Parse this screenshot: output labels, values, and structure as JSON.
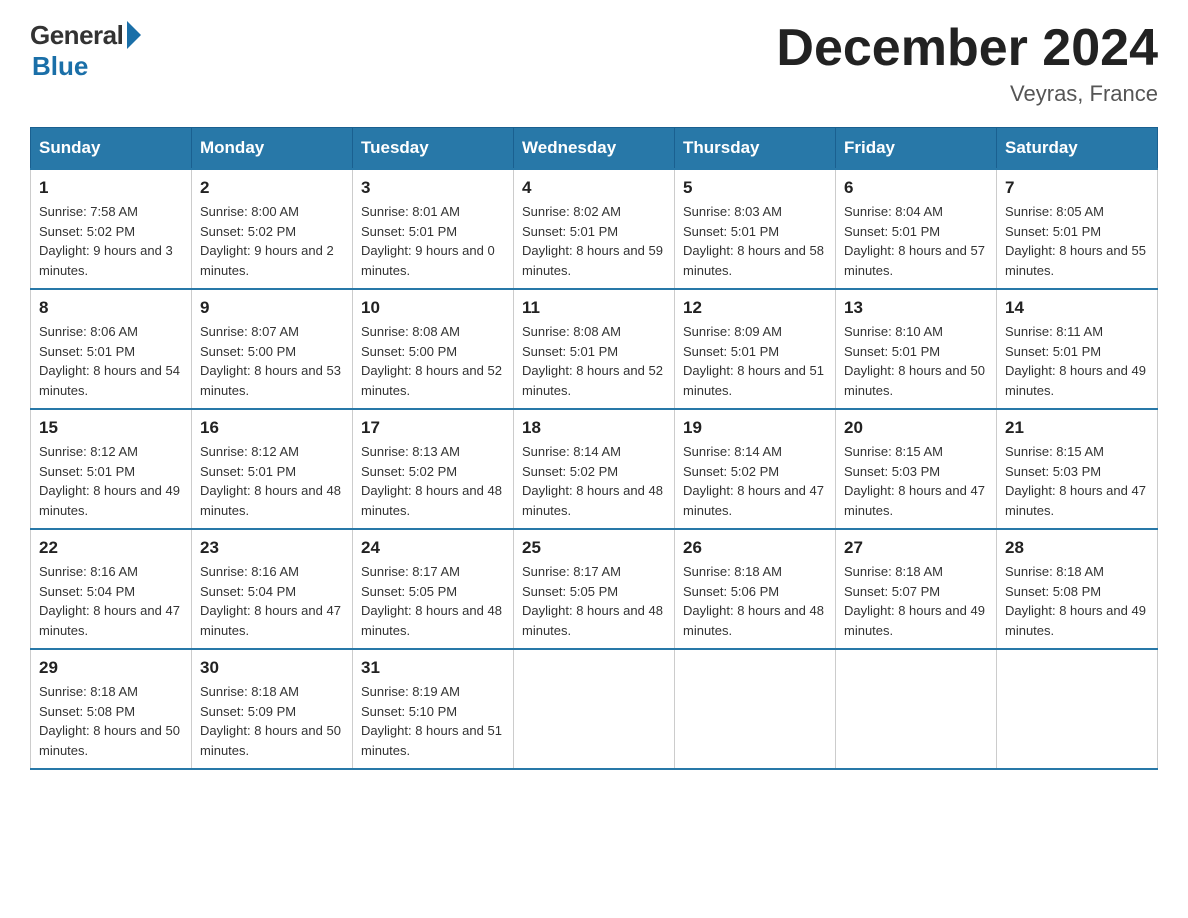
{
  "header": {
    "logo": {
      "general": "General",
      "blue": "Blue"
    },
    "title": "December 2024",
    "location": "Veyras, France"
  },
  "days_of_week": [
    "Sunday",
    "Monday",
    "Tuesday",
    "Wednesday",
    "Thursday",
    "Friday",
    "Saturday"
  ],
  "weeks": [
    [
      {
        "day": "1",
        "sunrise": "7:58 AM",
        "sunset": "5:02 PM",
        "daylight": "9 hours and 3 minutes."
      },
      {
        "day": "2",
        "sunrise": "8:00 AM",
        "sunset": "5:02 PM",
        "daylight": "9 hours and 2 minutes."
      },
      {
        "day": "3",
        "sunrise": "8:01 AM",
        "sunset": "5:01 PM",
        "daylight": "9 hours and 0 minutes."
      },
      {
        "day": "4",
        "sunrise": "8:02 AM",
        "sunset": "5:01 PM",
        "daylight": "8 hours and 59 minutes."
      },
      {
        "day": "5",
        "sunrise": "8:03 AM",
        "sunset": "5:01 PM",
        "daylight": "8 hours and 58 minutes."
      },
      {
        "day": "6",
        "sunrise": "8:04 AM",
        "sunset": "5:01 PM",
        "daylight": "8 hours and 57 minutes."
      },
      {
        "day": "7",
        "sunrise": "8:05 AM",
        "sunset": "5:01 PM",
        "daylight": "8 hours and 55 minutes."
      }
    ],
    [
      {
        "day": "8",
        "sunrise": "8:06 AM",
        "sunset": "5:01 PM",
        "daylight": "8 hours and 54 minutes."
      },
      {
        "day": "9",
        "sunrise": "8:07 AM",
        "sunset": "5:00 PM",
        "daylight": "8 hours and 53 minutes."
      },
      {
        "day": "10",
        "sunrise": "8:08 AM",
        "sunset": "5:00 PM",
        "daylight": "8 hours and 52 minutes."
      },
      {
        "day": "11",
        "sunrise": "8:08 AM",
        "sunset": "5:01 PM",
        "daylight": "8 hours and 52 minutes."
      },
      {
        "day": "12",
        "sunrise": "8:09 AM",
        "sunset": "5:01 PM",
        "daylight": "8 hours and 51 minutes."
      },
      {
        "day": "13",
        "sunrise": "8:10 AM",
        "sunset": "5:01 PM",
        "daylight": "8 hours and 50 minutes."
      },
      {
        "day": "14",
        "sunrise": "8:11 AM",
        "sunset": "5:01 PM",
        "daylight": "8 hours and 49 minutes."
      }
    ],
    [
      {
        "day": "15",
        "sunrise": "8:12 AM",
        "sunset": "5:01 PM",
        "daylight": "8 hours and 49 minutes."
      },
      {
        "day": "16",
        "sunrise": "8:12 AM",
        "sunset": "5:01 PM",
        "daylight": "8 hours and 48 minutes."
      },
      {
        "day": "17",
        "sunrise": "8:13 AM",
        "sunset": "5:02 PM",
        "daylight": "8 hours and 48 minutes."
      },
      {
        "day": "18",
        "sunrise": "8:14 AM",
        "sunset": "5:02 PM",
        "daylight": "8 hours and 48 minutes."
      },
      {
        "day": "19",
        "sunrise": "8:14 AM",
        "sunset": "5:02 PM",
        "daylight": "8 hours and 47 minutes."
      },
      {
        "day": "20",
        "sunrise": "8:15 AM",
        "sunset": "5:03 PM",
        "daylight": "8 hours and 47 minutes."
      },
      {
        "day": "21",
        "sunrise": "8:15 AM",
        "sunset": "5:03 PM",
        "daylight": "8 hours and 47 minutes."
      }
    ],
    [
      {
        "day": "22",
        "sunrise": "8:16 AM",
        "sunset": "5:04 PM",
        "daylight": "8 hours and 47 minutes."
      },
      {
        "day": "23",
        "sunrise": "8:16 AM",
        "sunset": "5:04 PM",
        "daylight": "8 hours and 47 minutes."
      },
      {
        "day": "24",
        "sunrise": "8:17 AM",
        "sunset": "5:05 PM",
        "daylight": "8 hours and 48 minutes."
      },
      {
        "day": "25",
        "sunrise": "8:17 AM",
        "sunset": "5:05 PM",
        "daylight": "8 hours and 48 minutes."
      },
      {
        "day": "26",
        "sunrise": "8:18 AM",
        "sunset": "5:06 PM",
        "daylight": "8 hours and 48 minutes."
      },
      {
        "day": "27",
        "sunrise": "8:18 AM",
        "sunset": "5:07 PM",
        "daylight": "8 hours and 49 minutes."
      },
      {
        "day": "28",
        "sunrise": "8:18 AM",
        "sunset": "5:08 PM",
        "daylight": "8 hours and 49 minutes."
      }
    ],
    [
      {
        "day": "29",
        "sunrise": "8:18 AM",
        "sunset": "5:08 PM",
        "daylight": "8 hours and 50 minutes."
      },
      {
        "day": "30",
        "sunrise": "8:18 AM",
        "sunset": "5:09 PM",
        "daylight": "8 hours and 50 minutes."
      },
      {
        "day": "31",
        "sunrise": "8:19 AM",
        "sunset": "5:10 PM",
        "daylight": "8 hours and 51 minutes."
      },
      null,
      null,
      null,
      null
    ]
  ],
  "labels": {
    "sunrise": "Sunrise:",
    "sunset": "Sunset:",
    "daylight": "Daylight:"
  }
}
